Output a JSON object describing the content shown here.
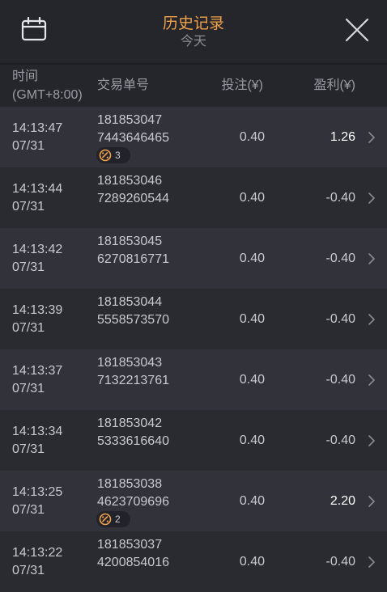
{
  "header": {
    "title": "历史记录",
    "subtitle": "今天",
    "calendar_icon": "calendar-icon",
    "close_icon": "close-icon"
  },
  "columns": {
    "time_line1": "时间",
    "time_line2": "(GMT+8:00)",
    "tx": "交易单号",
    "bet": "投注(¥)",
    "pl": "盈利(¥)"
  },
  "colors": {
    "title": "#f0a24a",
    "win": "#ffffff",
    "text": "#c9c9cf"
  },
  "rows": [
    {
      "time": "14:13:47",
      "date": "07/31",
      "tx1": "181853047",
      "tx2": "7443646465",
      "badge": "3",
      "bet": "0.40",
      "pl": "1.26"
    },
    {
      "time": "14:13:44",
      "date": "07/31",
      "tx1": "181853046",
      "tx2": "7289260544",
      "badge": "",
      "bet": "0.40",
      "pl": "-0.40"
    },
    {
      "time": "14:13:42",
      "date": "07/31",
      "tx1": "181853045",
      "tx2": "6270816771",
      "badge": "",
      "bet": "0.40",
      "pl": "-0.40"
    },
    {
      "time": "14:13:39",
      "date": "07/31",
      "tx1": "181853044",
      "tx2": "5558573570",
      "badge": "",
      "bet": "0.40",
      "pl": "-0.40"
    },
    {
      "time": "14:13:37",
      "date": "07/31",
      "tx1": "181853043",
      "tx2": "7132213761",
      "badge": "",
      "bet": "0.40",
      "pl": "-0.40"
    },
    {
      "time": "14:13:34",
      "date": "07/31",
      "tx1": "181853042",
      "tx2": "5333616640",
      "badge": "",
      "bet": "0.40",
      "pl": "-0.40"
    },
    {
      "time": "14:13:25",
      "date": "07/31",
      "tx1": "181853038",
      "tx2": "4623709696",
      "badge": "2",
      "bet": "0.40",
      "pl": "2.20"
    },
    {
      "time": "14:13:22",
      "date": "07/31",
      "tx1": "181853037",
      "tx2": "4200854016",
      "badge": "",
      "bet": "0.40",
      "pl": "-0.40"
    }
  ]
}
